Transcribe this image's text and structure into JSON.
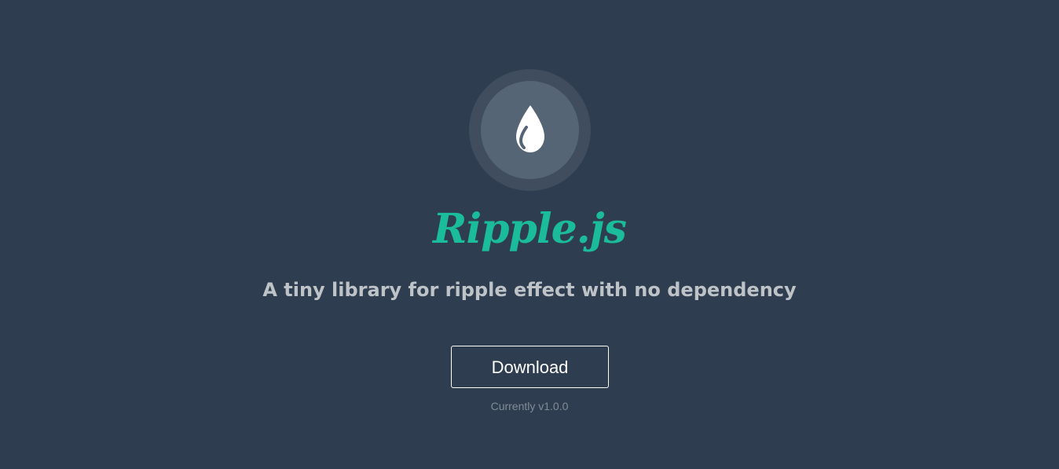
{
  "logo": {
    "icon": "water-drop-icon"
  },
  "header": {
    "title": "Ripple.js",
    "tagline": "A tiny library for ripple effect with no dependency"
  },
  "actions": {
    "download_label": "Download",
    "version_text": "Currently v1.0.0"
  },
  "colors": {
    "background": "#2f3d50",
    "accent": "#1abc9c",
    "tagline": "#bdc3c7",
    "button_border": "#ffffff"
  }
}
